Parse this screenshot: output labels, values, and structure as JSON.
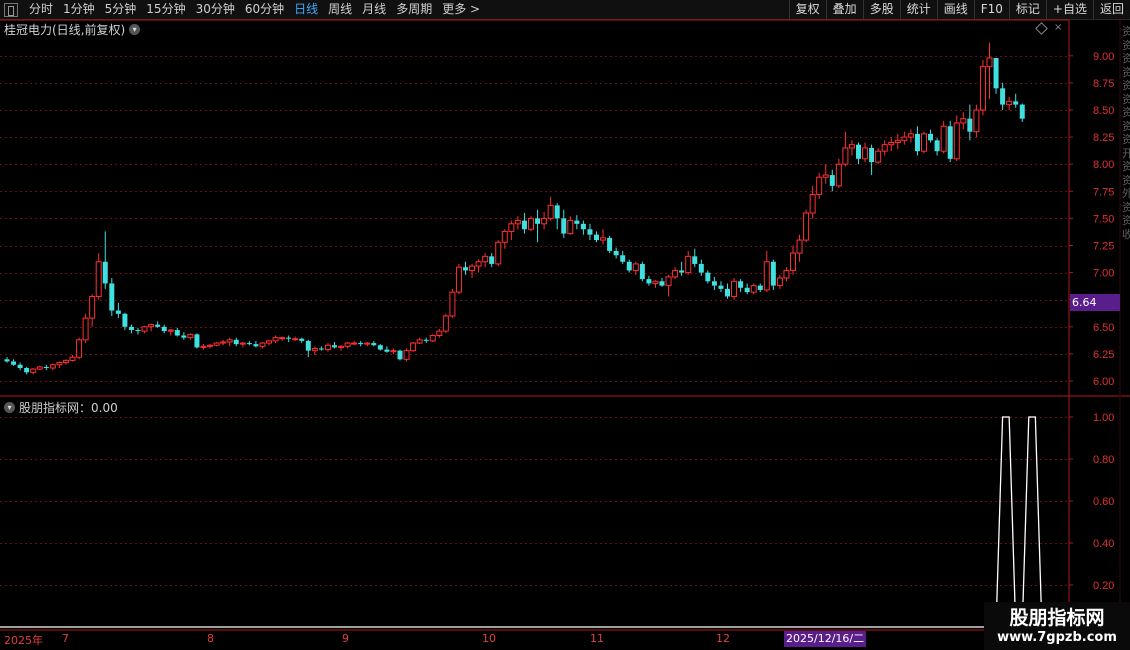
{
  "toolbar": {
    "periods": [
      "分时",
      "1分钟",
      "5分钟",
      "15分钟",
      "30分钟",
      "60分钟",
      "日线",
      "周线",
      "月线",
      "多周期",
      "更多 >"
    ],
    "active_index": 6,
    "right_buttons": [
      "复权",
      "叠加",
      "多股",
      "统计",
      "画线",
      "F10",
      "标记",
      "+自选",
      "返回"
    ]
  },
  "chart_header": {
    "title": "桂冠电力(日线,前复权)"
  },
  "indicator_header": {
    "label": "股朋指标网：0.00"
  },
  "price_tag": "6.64",
  "watermark": {
    "line1": "股朋指标网",
    "line2": "www.7gpzb.com"
  },
  "dates": {
    "start": "2025年",
    "months": [
      "7",
      "8",
      "9",
      "10",
      "11",
      "12"
    ],
    "current": "2025/12/16/二"
  },
  "colors": {
    "up": "#ff3030",
    "down": "#40e0e0",
    "grid": "#6e0f0f",
    "axis": "#b01818"
  },
  "chart_data": [
    {
      "type": "candlestick",
      "y_ticks": [
        "9.00",
        "8.75",
        "8.50",
        "8.25",
        "8.00",
        "7.75",
        "7.50",
        "7.25",
        "7.00",
        "6.75",
        "6.50",
        "6.25",
        "6.00"
      ],
      "ylim": [
        5.91,
        9.1
      ],
      "bars": [
        [
          6.2,
          6.22,
          6.17,
          6.18
        ],
        [
          6.18,
          6.2,
          6.14,
          6.15
        ],
        [
          6.15,
          6.17,
          6.1,
          6.12
        ],
        [
          6.12,
          6.13,
          6.06,
          6.08
        ],
        [
          6.08,
          6.12,
          6.06,
          6.11
        ],
        [
          6.11,
          6.14,
          6.1,
          6.13
        ],
        [
          6.13,
          6.15,
          6.1,
          6.12
        ],
        [
          6.12,
          6.16,
          6.1,
          6.15
        ],
        [
          6.15,
          6.18,
          6.12,
          6.17
        ],
        [
          6.17,
          6.2,
          6.15,
          6.19
        ],
        [
          6.19,
          6.24,
          6.18,
          6.22
        ],
        [
          6.22,
          6.4,
          6.2,
          6.38
        ],
        [
          6.38,
          6.62,
          6.35,
          6.58
        ],
        [
          6.58,
          6.8,
          6.5,
          6.78
        ],
        [
          6.78,
          7.18,
          6.75,
          7.1
        ],
        [
          7.1,
          7.38,
          6.85,
          6.9
        ],
        [
          6.9,
          6.95,
          6.6,
          6.65
        ],
        [
          6.65,
          6.72,
          6.58,
          6.62
        ],
        [
          6.62,
          6.63,
          6.47,
          6.5
        ],
        [
          6.5,
          6.52,
          6.44,
          6.47
        ],
        [
          6.47,
          6.49,
          6.43,
          6.46
        ],
        [
          6.46,
          6.51,
          6.44,
          6.5
        ],
        [
          6.5,
          6.53,
          6.46,
          6.52
        ],
        [
          6.52,
          6.55,
          6.49,
          6.5
        ],
        [
          6.5,
          6.52,
          6.44,
          6.46
        ],
        [
          6.46,
          6.48,
          6.42,
          6.47
        ],
        [
          6.47,
          6.49,
          6.41,
          6.42
        ],
        [
          6.42,
          6.45,
          6.38,
          6.4
        ],
        [
          6.4,
          6.44,
          6.38,
          6.43
        ],
        [
          6.43,
          6.44,
          6.3,
          6.31
        ],
        [
          6.31,
          6.34,
          6.29,
          6.32
        ],
        [
          6.32,
          6.34,
          6.3,
          6.33
        ],
        [
          6.33,
          6.36,
          6.32,
          6.35
        ],
        [
          6.35,
          6.38,
          6.33,
          6.36
        ],
        [
          6.36,
          6.4,
          6.32,
          6.38
        ],
        [
          6.38,
          6.4,
          6.32,
          6.34
        ],
        [
          6.34,
          6.36,
          6.31,
          6.35
        ],
        [
          6.35,
          6.37,
          6.33,
          6.34
        ],
        [
          6.34,
          6.37,
          6.31,
          6.32
        ],
        [
          6.32,
          6.36,
          6.3,
          6.35
        ],
        [
          6.35,
          6.38,
          6.33,
          6.37
        ],
        [
          6.37,
          6.42,
          6.35,
          6.4
        ],
        [
          6.4,
          6.41,
          6.37,
          6.4
        ],
        [
          6.4,
          6.42,
          6.36,
          6.39
        ],
        [
          6.39,
          6.41,
          6.37,
          6.39
        ],
        [
          6.39,
          6.4,
          6.35,
          6.37
        ],
        [
          6.37,
          6.38,
          6.22,
          6.28
        ],
        [
          6.28,
          6.32,
          6.24,
          6.3
        ],
        [
          6.3,
          6.32,
          6.28,
          6.29
        ],
        [
          6.29,
          6.35,
          6.27,
          6.33
        ],
        [
          6.33,
          6.36,
          6.3,
          6.31
        ],
        [
          6.31,
          6.33,
          6.28,
          6.32
        ],
        [
          6.32,
          6.36,
          6.3,
          6.35
        ],
        [
          6.35,
          6.37,
          6.33,
          6.35
        ],
        [
          6.35,
          6.37,
          6.32,
          6.34
        ],
        [
          6.34,
          6.36,
          6.32,
          6.35
        ],
        [
          6.35,
          6.37,
          6.32,
          6.33
        ],
        [
          6.33,
          6.34,
          6.28,
          6.29
        ],
        [
          6.29,
          6.32,
          6.26,
          6.27
        ],
        [
          6.27,
          6.3,
          6.25,
          6.28
        ],
        [
          6.28,
          6.29,
          6.19,
          6.2
        ],
        [
          6.2,
          6.3,
          6.18,
          6.28
        ],
        [
          6.28,
          6.36,
          6.27,
          6.35
        ],
        [
          6.35,
          6.4,
          6.34,
          6.38
        ],
        [
          6.38,
          6.4,
          6.35,
          6.37
        ],
        [
          6.37,
          6.43,
          6.36,
          6.42
        ],
        [
          6.42,
          6.48,
          6.4,
          6.46
        ],
        [
          6.46,
          6.62,
          6.44,
          6.6
        ],
        [
          6.6,
          6.85,
          6.58,
          6.82
        ],
        [
          6.82,
          7.08,
          6.8,
          7.05
        ],
        [
          7.05,
          7.1,
          6.98,
          7.02
        ],
        [
          7.02,
          7.08,
          6.95,
          7.06
        ],
        [
          7.06,
          7.12,
          7.0,
          7.1
        ],
        [
          7.1,
          7.18,
          7.05,
          7.15
        ],
        [
          7.15,
          7.18,
          7.05,
          7.08
        ],
        [
          7.08,
          7.3,
          7.06,
          7.28
        ],
        [
          7.28,
          7.4,
          7.22,
          7.38
        ],
        [
          7.38,
          7.48,
          7.3,
          7.45
        ],
        [
          7.45,
          7.52,
          7.4,
          7.48
        ],
        [
          7.48,
          7.55,
          7.36,
          7.4
        ],
        [
          7.4,
          7.52,
          7.38,
          7.5
        ],
        [
          7.5,
          7.58,
          7.28,
          7.45
        ],
        [
          7.45,
          7.56,
          7.4,
          7.5
        ],
        [
          7.5,
          7.7,
          7.48,
          7.62
        ],
        [
          7.62,
          7.64,
          7.4,
          7.5
        ],
        [
          7.5,
          7.58,
          7.32,
          7.36
        ],
        [
          7.36,
          7.52,
          7.35,
          7.48
        ],
        [
          7.48,
          7.53,
          7.4,
          7.45
        ],
        [
          7.45,
          7.48,
          7.35,
          7.4
        ],
        [
          7.4,
          7.45,
          7.3,
          7.35
        ],
        [
          7.35,
          7.38,
          7.28,
          7.3
        ],
        [
          7.3,
          7.4,
          7.26,
          7.32
        ],
        [
          7.32,
          7.34,
          7.18,
          7.2
        ],
        [
          7.2,
          7.23,
          7.13,
          7.16
        ],
        [
          7.16,
          7.2,
          7.08,
          7.1
        ],
        [
          7.1,
          7.12,
          7.0,
          7.02
        ],
        [
          7.02,
          7.1,
          6.98,
          7.08
        ],
        [
          7.08,
          7.1,
          6.92,
          6.94
        ],
        [
          6.94,
          6.97,
          6.88,
          6.9
        ],
        [
          6.9,
          6.93,
          6.86,
          6.92
        ],
        [
          6.92,
          6.95,
          6.87,
          6.88
        ],
        [
          6.88,
          6.98,
          6.78,
          6.96
        ],
        [
          6.96,
          7.05,
          6.94,
          7.02
        ],
        [
          7.02,
          7.1,
          6.97,
          7.0
        ],
        [
          7.0,
          7.2,
          6.98,
          7.15
        ],
        [
          7.15,
          7.22,
          7.05,
          7.08
        ],
        [
          7.08,
          7.12,
          6.97,
          7.0
        ],
        [
          7.0,
          7.02,
          6.9,
          6.92
        ],
        [
          6.92,
          6.96,
          6.84,
          6.88
        ],
        [
          6.88,
          6.92,
          6.82,
          6.85
        ],
        [
          6.85,
          6.9,
          6.76,
          6.78
        ],
        [
          6.78,
          6.95,
          6.75,
          6.92
        ],
        [
          6.92,
          6.94,
          6.82,
          6.86
        ],
        [
          6.86,
          6.9,
          6.8,
          6.82
        ],
        [
          6.82,
          6.9,
          6.8,
          6.88
        ],
        [
          6.88,
          6.9,
          6.82,
          6.84
        ],
        [
          6.84,
          7.2,
          6.82,
          7.1
        ],
        [
          7.1,
          7.12,
          6.84,
          6.88
        ],
        [
          6.88,
          6.98,
          6.85,
          6.95
        ],
        [
          6.95,
          7.05,
          6.92,
          7.02
        ],
        [
          7.02,
          7.25,
          6.98,
          7.18
        ],
        [
          7.18,
          7.35,
          7.1,
          7.3
        ],
        [
          7.3,
          7.58,
          7.28,
          7.55
        ],
        [
          7.55,
          7.8,
          7.5,
          7.72
        ],
        [
          7.72,
          7.92,
          7.68,
          7.88
        ],
        [
          7.88,
          8.0,
          7.82,
          7.9
        ],
        [
          7.9,
          7.95,
          7.75,
          7.8
        ],
        [
          7.8,
          8.05,
          7.78,
          8.0
        ],
        [
          8.0,
          8.3,
          7.98,
          8.15
        ],
        [
          8.15,
          8.22,
          8.08,
          8.18
        ],
        [
          8.18,
          8.2,
          8.0,
          8.05
        ],
        [
          8.05,
          8.2,
          8.02,
          8.15
        ],
        [
          8.15,
          8.18,
          7.9,
          8.02
        ],
        [
          8.02,
          8.15,
          8.0,
          8.12
        ],
        [
          8.12,
          8.22,
          8.08,
          8.18
        ],
        [
          8.18,
          8.25,
          8.12,
          8.2
        ],
        [
          8.2,
          8.28,
          8.14,
          8.22
        ],
        [
          8.22,
          8.3,
          8.18,
          8.25
        ],
        [
          8.25,
          8.32,
          8.2,
          8.28
        ],
        [
          8.28,
          8.35,
          8.08,
          8.12
        ],
        [
          8.12,
          8.3,
          8.1,
          8.28
        ],
        [
          8.28,
          8.32,
          8.2,
          8.22
        ],
        [
          8.22,
          8.24,
          8.08,
          8.12
        ],
        [
          8.12,
          8.4,
          8.1,
          8.35
        ],
        [
          8.35,
          8.4,
          8.02,
          8.05
        ],
        [
          8.05,
          8.45,
          8.03,
          8.38
        ],
        [
          8.38,
          8.48,
          8.32,
          8.42
        ],
        [
          8.42,
          8.55,
          8.22,
          8.3
        ],
        [
          8.3,
          8.55,
          8.25,
          8.5
        ],
        [
          8.5,
          8.96,
          8.45,
          8.9
        ],
        [
          8.9,
          9.12,
          8.6,
          8.98
        ],
        [
          8.98,
          8.92,
          8.65,
          8.7
        ],
        [
          8.7,
          8.75,
          8.5,
          8.55
        ],
        [
          8.55,
          8.62,
          8.5,
          8.58
        ],
        [
          8.58,
          8.65,
          8.52,
          8.55
        ],
        [
          8.55,
          8.56,
          8.39,
          8.42
        ]
      ]
    },
    {
      "type": "line",
      "name": "股朋指标网",
      "y_ticks": [
        "1.00",
        "0.80",
        "0.60",
        "0.40",
        "0.20"
      ],
      "ylim": [
        0,
        1
      ],
      "x": [
        0,
        151,
        152,
        153,
        154,
        155,
        156,
        157,
        158,
        159,
        160
      ],
      "values": [
        0,
        0,
        1,
        1,
        0,
        0,
        1,
        1,
        0,
        0,
        0
      ]
    }
  ]
}
